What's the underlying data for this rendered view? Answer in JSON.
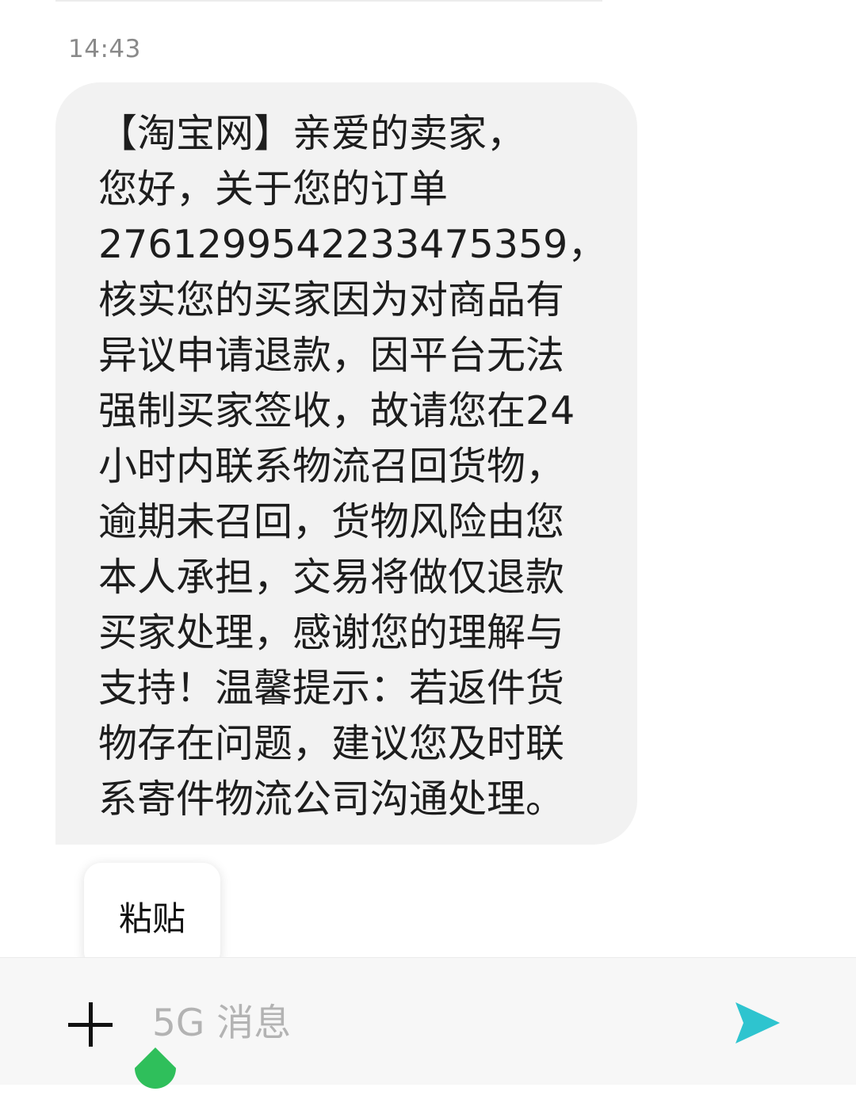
{
  "conversation": {
    "timestamp": "14:43",
    "message": {
      "text": "【淘宝网】亲爱的卖家，\n您好，关于您的订单\n2761299542233475359，\n核实您的买家因为对商品有\n异议申请退款，因平台无法\n强制买家签收，故请您在24\n小时内联系物流召回货物，\n逾期未召回，货物风险由您\n本人承担，交易将做仅退款\n买家处理，感谢您的理解与\n支持！温馨提示：若返件货\n物存在问题，建议您及时联\n系寄件物流公司沟通处理。"
    }
  },
  "context_menu": {
    "paste_label": "粘贴"
  },
  "composer": {
    "placeholder": "5G 消息",
    "value": ""
  },
  "icons": {
    "plus": "plus-icon",
    "send": "send-icon",
    "cursor_handle": "text-cursor-handle-icon"
  },
  "colors": {
    "bubble_bg": "#f2f2f2",
    "send_accent": "#2ec4cf",
    "cursor_handle": "#2fbf5b"
  }
}
